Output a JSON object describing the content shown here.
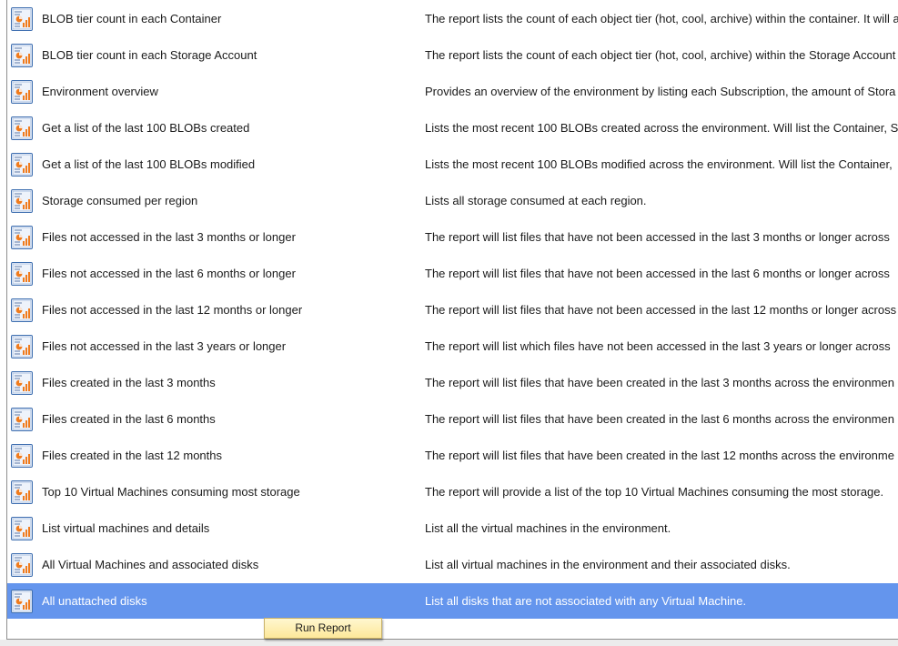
{
  "reports": [
    {
      "name": "BLOB tier count in each Container",
      "description": "The report lists the count of each object tier (hot, cool, archive) within the container. It will a",
      "icon": "report-chart-icon"
    },
    {
      "name": "BLOB tier count in each Storage Account",
      "description": "The report lists the count of each object tier (hot, cool, archive) within the Storage Account",
      "icon": "report-chart-icon"
    },
    {
      "name": "Environment overview",
      "description": "Provides an overview of the environment by listing each Subscription, the amount of Stora",
      "icon": "report-chart-icon"
    },
    {
      "name": "Get a list of the last 100 BLOBs created",
      "description": "Lists the most recent 100 BLOBs created across the environment. Will list the Container, S",
      "icon": "report-chart-icon"
    },
    {
      "name": "Get a list of the last 100 BLOBs modified",
      "description": "Lists the most recent 100 BLOBs modified across the environment. Will list the Container,",
      "icon": "report-chart-icon"
    },
    {
      "name": "Storage consumed per region",
      "description": "Lists all storage consumed at each region.",
      "icon": "report-chart-icon"
    },
    {
      "name": "Files not accessed in the last 3 months or longer",
      "description": "The report will list files that have not been accessed in the last 3 months or longer across",
      "icon": "report-chart-icon"
    },
    {
      "name": "Files not accessed in the last 6 months or longer",
      "description": "The report will list files that have not been accessed in the last 6 months or longer across",
      "icon": "report-chart-icon"
    },
    {
      "name": "Files not accessed in the last 12 months or longer",
      "description": "The report will list files that have not been accessed in the last 12 months or longer across",
      "icon": "report-chart-icon"
    },
    {
      "name": "Files not accessed in the last 3 years or longer",
      "description": "The report will list which files have not been accessed in the last 3 years or longer across",
      "icon": "report-chart-icon"
    },
    {
      "name": "Files created in the last 3 months",
      "description": "The report will list files that have been created in the last 3 months across the environmen",
      "icon": "report-chart-icon"
    },
    {
      "name": "Files created in the last 6 months",
      "description": "The report will list files that have been created in the last 6 months across the environmen",
      "icon": "report-chart-icon"
    },
    {
      "name": "Files created in the last 12 months",
      "description": "The report will list files that have been created in the last 12 months across the environme",
      "icon": "report-chart-icon"
    },
    {
      "name": "Top 10 Virtual Machines consuming most storage",
      "description": "The report will provide a list of the top 10 Virtual Machines consuming the most storage.",
      "icon": "report-chart-icon"
    },
    {
      "name": "List virtual machines and details",
      "description": "List all the virtual machines in the environment.",
      "icon": "report-chart-icon"
    },
    {
      "name": "All Virtual Machines and associated disks",
      "description": "List all virtual machines in the environment and their associated disks.",
      "icon": "report-chart-icon"
    },
    {
      "name": "All unattached disks",
      "description": "List all disks that are not associated with any Virtual Machine.",
      "icon": "report-chart-icon",
      "selected": true
    }
  ],
  "context_menu": {
    "run_report_label": "Run Report"
  },
  "colors": {
    "selection": "#6495ed",
    "menu_background": "#fdf1b8",
    "icon_frame": "#4a78b8",
    "icon_chart": "#f07b1d"
  }
}
